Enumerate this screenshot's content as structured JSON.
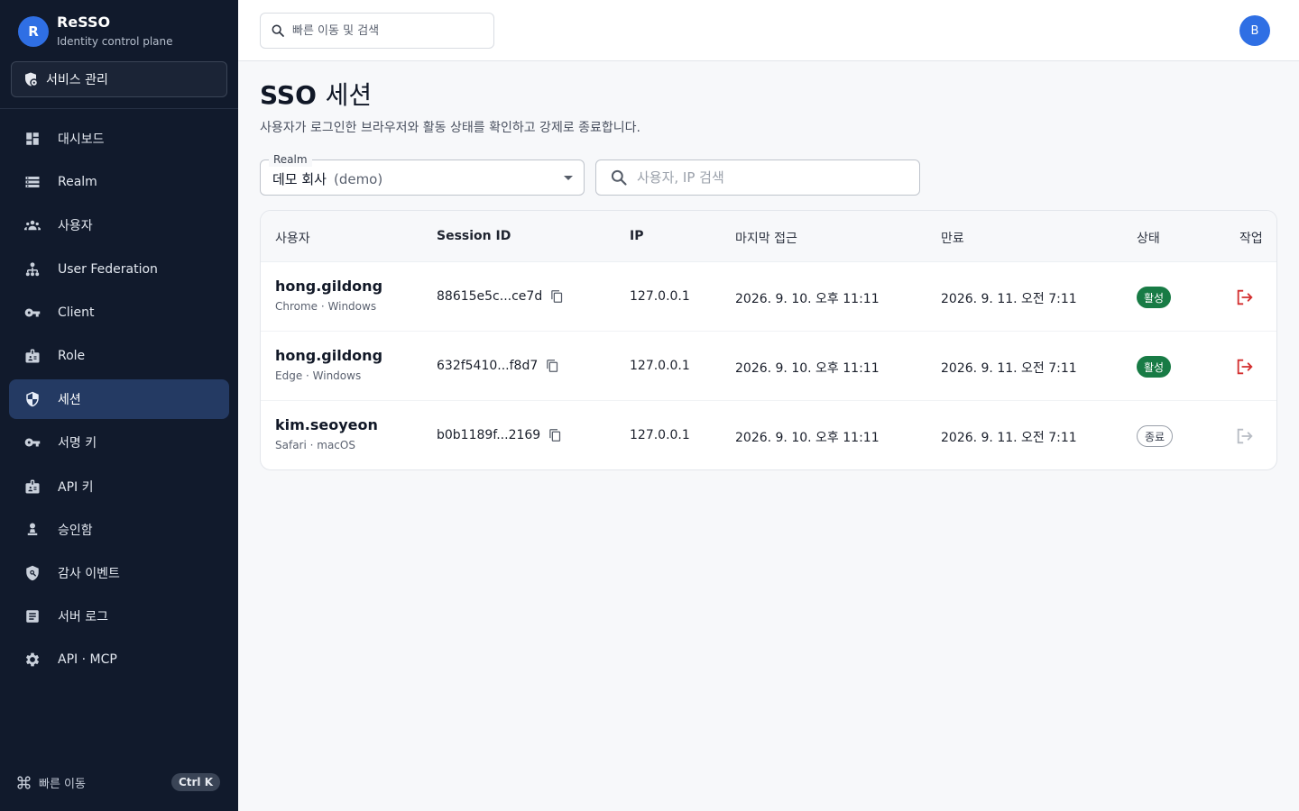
{
  "brand": {
    "logo_letter": "R",
    "name": "ReSSO",
    "subtitle": "Identity control plane",
    "accent": "#2f6fe4"
  },
  "sidebar": {
    "service_button": "서비스 관리",
    "items": [
      {
        "label": "대시보드",
        "icon": "dashboard-icon",
        "active": false
      },
      {
        "label": "Realm",
        "icon": "storage-icon",
        "active": false
      },
      {
        "label": "사용자",
        "icon": "people-icon",
        "active": false
      },
      {
        "label": "User Federation",
        "icon": "hierarchy-icon",
        "active": false
      },
      {
        "label": "Client",
        "icon": "key-icon",
        "active": false
      },
      {
        "label": "Role",
        "icon": "badge-icon",
        "active": false
      },
      {
        "label": "세션",
        "icon": "shield-icon",
        "active": true
      },
      {
        "label": "서명 키",
        "icon": "key-icon",
        "active": false
      },
      {
        "label": "API 키",
        "icon": "badge-icon",
        "active": false
      },
      {
        "label": "승인함",
        "icon": "approval-icon",
        "active": false
      },
      {
        "label": "감사 이벤트",
        "icon": "audit-shield-icon",
        "active": false
      },
      {
        "label": "서버 로그",
        "icon": "document-icon",
        "active": false
      },
      {
        "label": "API · MCP",
        "icon": "gear-icon",
        "active": false
      }
    ],
    "footer": {
      "label": "빠른 이동",
      "shortcut": "Ctrl K"
    }
  },
  "topbar": {
    "search_placeholder": "빠른 이동 및 검색",
    "avatar_letter": "B"
  },
  "page": {
    "title_en": "SSO",
    "title_kr": "세션",
    "description": "사용자가 로그인한 브라우저와 활동 상태를 확인하고 강제로 종료합니다."
  },
  "filters": {
    "realm_label": "Realm",
    "realm_name": "데모 회사",
    "realm_slug": "(demo)",
    "search_placeholder": "사용자, IP 검색"
  },
  "table": {
    "headers": {
      "user": "사용자",
      "session_id": "Session ID",
      "ip": "IP",
      "last_access": "마지막 접근",
      "expires": "만료",
      "status": "상태",
      "actions": "작업"
    },
    "rows": [
      {
        "user": "hong.gildong",
        "agent": "Chrome · Windows",
        "session_id": "88615e5c...ce7d",
        "ip": "127.0.0.1",
        "last_access": "2026. 9. 10. 오후 11:11",
        "expires": "2026. 9. 11. 오전 7:11",
        "status": "활성",
        "status_type": "active"
      },
      {
        "user": "hong.gildong",
        "agent": "Edge · Windows",
        "session_id": "632f5410...f8d7",
        "ip": "127.0.0.1",
        "last_access": "2026. 9. 10. 오후 11:11",
        "expires": "2026. 9. 11. 오전 7:11",
        "status": "활성",
        "status_type": "active"
      },
      {
        "user": "kim.seoyeon",
        "agent": "Safari · macOS",
        "session_id": "b0b1189f...2169",
        "ip": "127.0.0.1",
        "last_access": "2026. 9. 10. 오후 11:11",
        "expires": "2026. 9. 11. 오전 7:11",
        "status": "종료",
        "status_type": "ended"
      }
    ]
  },
  "colors": {
    "sidebar_bg": "#111a2c",
    "active_nav": "#243a63",
    "status_active": "#187b45",
    "logout_active": "#d32f2f",
    "logout_disabled": "#b7bcc4"
  }
}
